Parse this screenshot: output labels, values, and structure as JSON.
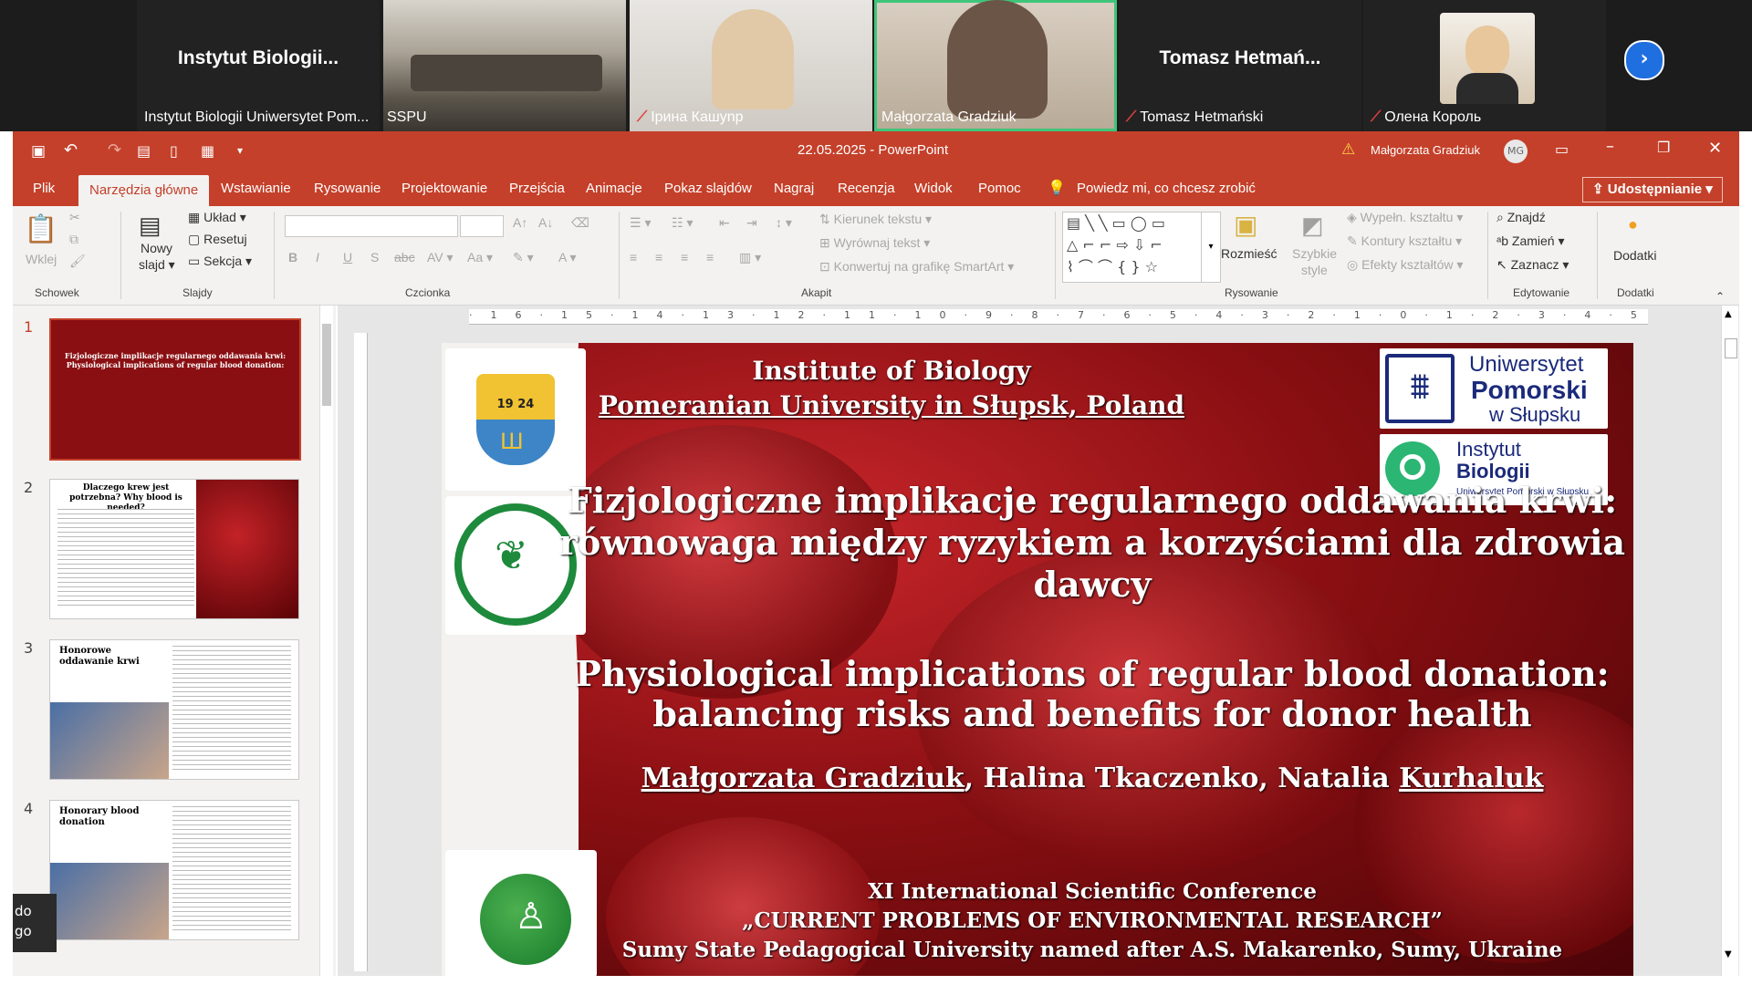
{
  "participants": [
    {
      "name_big": "Instytut  Biologii...",
      "caption": "Instytut Biologii Uniwersytet Pom...",
      "muted": false
    },
    {
      "name_big": "",
      "caption": "SSPU",
      "muted": false
    },
    {
      "name_big": "",
      "caption": "Ірина Кашуnр",
      "muted": true
    },
    {
      "name_big": "",
      "caption": "Małgorzata Gradziuk",
      "muted": false
    },
    {
      "name_big": "Tomasz  Hetmań...",
      "caption": "Tomasz Hetmański",
      "muted": true
    },
    {
      "name_big": "",
      "caption": "Олена Король",
      "muted": true
    }
  ],
  "ppt": {
    "title": "22.05.2025  -  PowerPoint",
    "user": "Małgorzata Gradziuk",
    "avatar": "MG",
    "tabs": [
      "Plik",
      "Narzędzia główne",
      "Wstawianie",
      "Rysowanie",
      "Projektowanie",
      "Przejścia",
      "Animacje",
      "Pokaz slajdów",
      "Nagraj",
      "Recenzja",
      "Widok",
      "Pomoc"
    ],
    "tell_me": "Powiedz mi, co chcesz zrobić",
    "share": "Udostępnianie",
    "ribbon": {
      "wklej": "Wklej",
      "nowy": "Nowy",
      "slajd": "slajd",
      "uklad": "Układ",
      "resetuj": "Resetuj",
      "sekcja": "Sekcja",
      "kierunek": "Kierunek tekstu",
      "wyrownaj": "Wyrównaj tekst",
      "konwertuj": "Konwertuj na grafikę SmartArt",
      "rozmiesc": "Rozmieść",
      "szybkie": "Szybkie",
      "style": "style",
      "wypeln": "Wypełn. kształtu",
      "kontury": "Kontury kształtu",
      "efekty": "Efekty kształtów",
      "znajdz": "Znajdź",
      "zamien": "Zamień",
      "zaznacz": "Zaznacz",
      "dodatki": "Dodatki",
      "groups": [
        "Schowek",
        "Slajdy",
        "Czcionka",
        "Akapit",
        "Rysowanie",
        "Edytowanie",
        "Dodatki"
      ]
    },
    "slide_numbers": [
      "1",
      "2",
      "3",
      "4"
    ],
    "thumbs": {
      "t2_title": "Dlaczego krew jest potrzebna? Why blood is needed?",
      "t3_title": "Honorowe oddawanie krwi",
      "t4_title": "Honorary blood donation"
    }
  },
  "slide": {
    "inst1": "Institute of Biology",
    "inst2": "Pomeranian University in Słupsk, Poland",
    "pl1": "Fizjologiczne implikacje regularnego oddawania krwi:",
    "pl2": "równowaga między ryzykiem a korzyściami dla zdrowia",
    "pl3": "dawcy",
    "en1": "Physiological implications of regular blood donation:",
    "en2": "balancing risks and benefits for donor health",
    "author1": "Małgorzata Gradziuk",
    "author2": ", Halina Tkaczenko, Natalia ",
    "author3": "Kurhaluk",
    "conf1": "XI International Scientific Conference",
    "conf2": "„CURRENT PROBLEMS OF ENVIRONMENTAL RESEARCH”",
    "conf3": "Sumy State Pedagogical University named after A.S. Makarenko, Sumy, Ukraine",
    "logo_up1": "Uniwersytet",
    "logo_up2": "Pomorski",
    "logo_up3": "w Słupsku",
    "logo_ib1": "Instytut",
    "logo_ib2": "Biologii",
    "logo_ib3": "Uniwersytet Pomorski w Słupsku",
    "logo_year": "19 24"
  },
  "sidebar_tip": [
    "do",
    "go"
  ],
  "colors": {
    "ppt_red": "#c4402a",
    "slide_red": "#8a0f12",
    "active_tile": "#3fc57a"
  }
}
